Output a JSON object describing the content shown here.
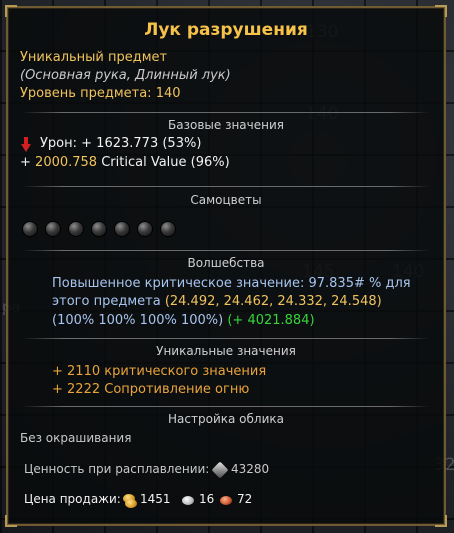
{
  "background": {
    "slot_numbers": [
      "130",
      "140",
      "145",
      "140",
      "32"
    ],
    "side_text": "ра"
  },
  "tooltip": {
    "title": "Лук разрушения",
    "rarity": "Уникальный предмет",
    "type_line": "(Основная рука, Длинный лук)",
    "item_level_label": "Уровень предмета:",
    "item_level": "140",
    "base_section": {
      "header": "Базовые значения",
      "damage_label": "Урон:",
      "damage_value": "+ 1623.773",
      "damage_pct": "(53%)",
      "crit_prefix": "+",
      "crit_value": "2000.758",
      "crit_label": "Critical Value",
      "crit_pct": "(96%)"
    },
    "gems_section": {
      "header": "Самоцветы",
      "gem_icons": [
        "empty-socket-icon",
        "empty-socket-icon",
        "empty-socket-icon",
        "empty-socket-icon",
        "empty-socket-icon",
        "empty-socket-icon",
        "empty-socket-icon"
      ]
    },
    "enchant_section": {
      "header": "Волшебства",
      "line1": "Повышенное критическое значение: 97.835# % для",
      "line2a": "этого предмета",
      "line2b": "(24.492, 24.462, 24.332, 24.548)",
      "line3a": "(100% 100% 100% 100%)",
      "line3b": "(+ 4021.884)"
    },
    "unique_section": {
      "header": "Уникальные значения",
      "line1": "+ 2110 критического значения",
      "line2": "+ 2222 Сопротивление огню"
    },
    "appearance_section": {
      "header": "Настройка облика",
      "value": "Без окрашивания"
    },
    "smelt": {
      "label": "Ценность при расплавлении:",
      "value": "43280"
    },
    "sell": {
      "label": "Цена продажи:",
      "gold": "1451",
      "silver": "16",
      "copper": "72"
    }
  },
  "colors": {
    "title": "#f7c24a",
    "gold_text": "#f0c35c",
    "enchant": "#a7c4ee",
    "bonus": "#38d43a",
    "unique": "#e9a33a",
    "border": "#6f5a31"
  }
}
